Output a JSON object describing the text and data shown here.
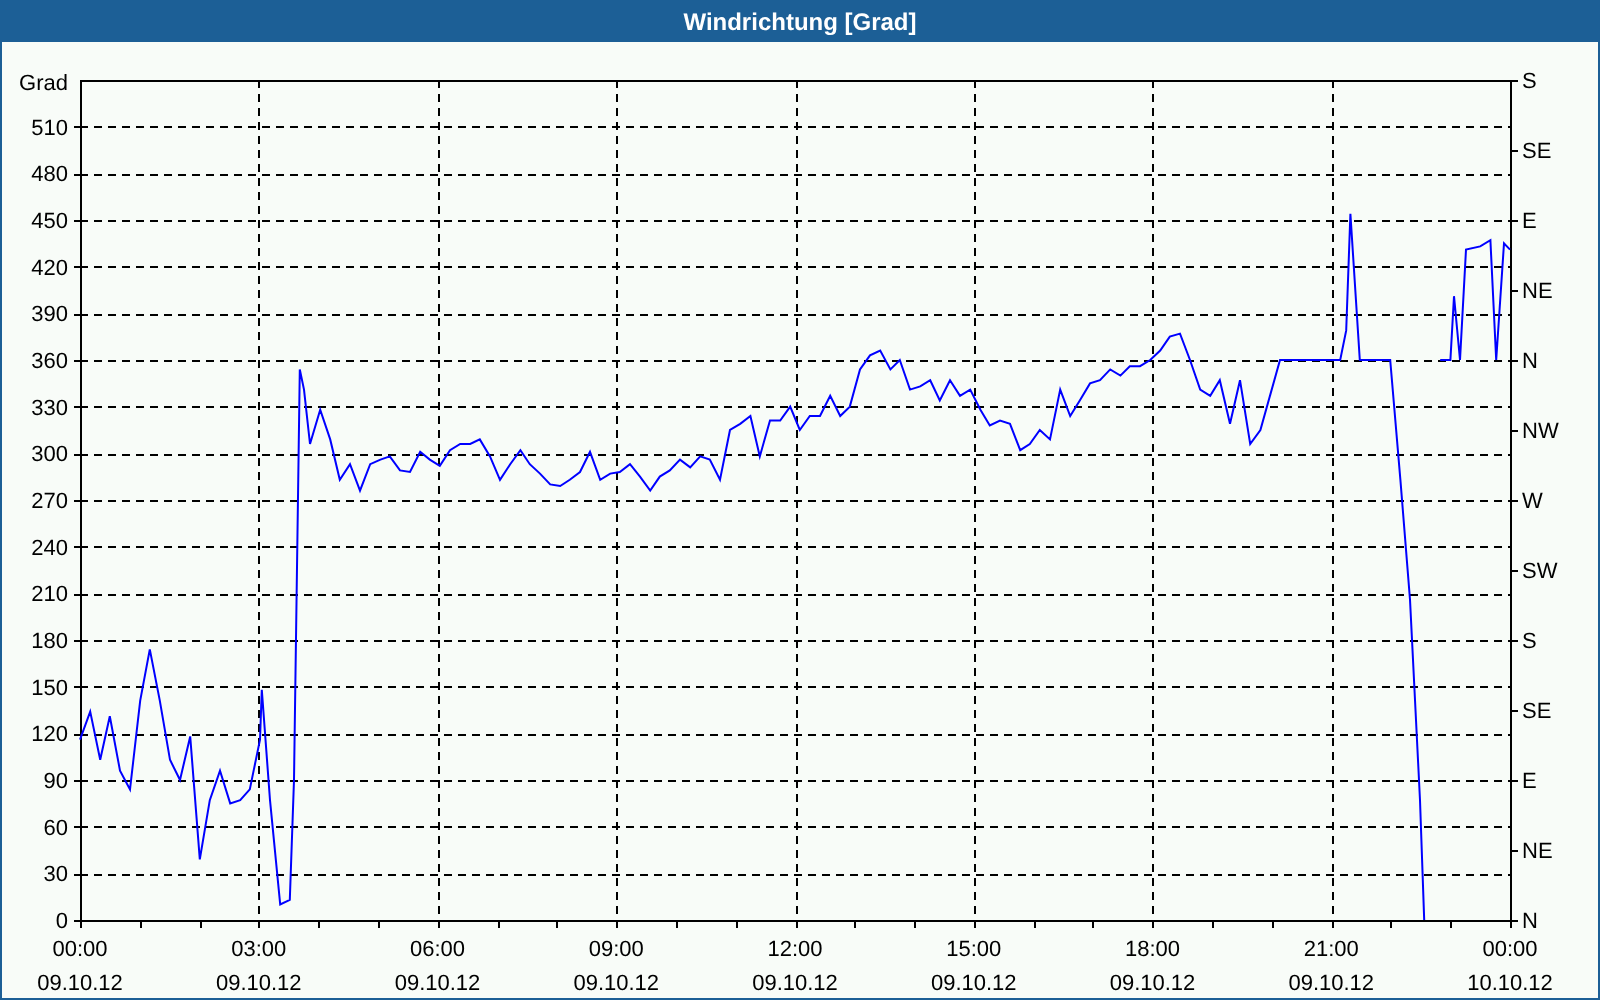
{
  "window": {
    "title": "Windrichtung [Grad]"
  },
  "chart": {
    "date_labels": [
      "09.10.12",
      "09.10.12",
      "09.10.12",
      "09.10.12",
      "09.10.12",
      "09.10.12",
      "09.10.12",
      "09.10.12",
      "10.10.12"
    ],
    "right_axis_labels": [
      "S",
      "SE",
      "E",
      "NE",
      "N",
      "NW",
      "W",
      "SW",
      "S",
      "SE",
      "E",
      "NE",
      "N"
    ],
    "chart_data": {
      "type": "line",
      "ylabel": "Grad",
      "xlim": [
        0,
        24
      ],
      "ylim": [
        0,
        540
      ],
      "grid": true,
      "xticks": [
        {
          "value": 0,
          "label": "00:00"
        },
        {
          "value": 3,
          "label": "03:00"
        },
        {
          "value": 6,
          "label": "06:00"
        },
        {
          "value": 9,
          "label": "09:00"
        },
        {
          "value": 12,
          "label": "12:00"
        },
        {
          "value": 15,
          "label": "15:00"
        },
        {
          "value": 18,
          "label": "18:00"
        },
        {
          "value": 21,
          "label": "21:00"
        },
        {
          "value": 24,
          "label": "00:00"
        }
      ],
      "yticks": [
        0,
        30,
        60,
        90,
        120,
        150,
        180,
        210,
        240,
        270,
        300,
        330,
        360,
        390,
        420,
        450,
        480,
        510
      ],
      "x": [
        0,
        0.17,
        0.34,
        0.5,
        0.67,
        0.84,
        1.01,
        1.17,
        1.34,
        1.51,
        1.68,
        1.85,
        2.01,
        2.18,
        2.35,
        2.52,
        2.69,
        2.85,
        3.02,
        3.05,
        3.19,
        3.36,
        3.52,
        3.59,
        3.69,
        3.76,
        3.86,
        4.03,
        4.2,
        4.36,
        4.53,
        4.7,
        4.87,
        5.04,
        5.2,
        5.37,
        5.54,
        5.71,
        5.87,
        6.04,
        6.21,
        6.38,
        6.55,
        6.71,
        6.88,
        7.05,
        7.22,
        7.39,
        7.55,
        7.72,
        7.89,
        8.06,
        8.22,
        8.39,
        8.56,
        8.73,
        8.9,
        9.06,
        9.23,
        9.4,
        9.57,
        9.73,
        9.9,
        10.07,
        10.24,
        10.41,
        10.57,
        10.74,
        10.91,
        11.08,
        11.25,
        11.41,
        11.58,
        11.75,
        11.92,
        12.08,
        12.25,
        12.42,
        12.59,
        12.76,
        12.92,
        13.09,
        13.26,
        13.43,
        13.6,
        13.76,
        13.93,
        14.1,
        14.27,
        14.43,
        14.6,
        14.77,
        14.94,
        15.11,
        15.27,
        15.44,
        15.61,
        15.78,
        15.94,
        16.11,
        16.28,
        16.45,
        16.62,
        16.78,
        16.95,
        17.12,
        17.29,
        17.46,
        17.62,
        17.79,
        17.96,
        18.13,
        18.29,
        18.46,
        18.63,
        18.8,
        18.97,
        19.13,
        19.3,
        19.47,
        19.64,
        19.81,
        20.14,
        21.15,
        21.25,
        21.32,
        21.48,
        21.99,
        22.16,
        22.32,
        22.49,
        22.56,
        22.7,
        22.83,
        23.0,
        23.06,
        23.16,
        23.26,
        23.5,
        23.67,
        23.77,
        23.9,
        24.0
      ],
      "series": [
        {
          "color": "#0000ff",
          "values": [
            116,
            134,
            103,
            131,
            96,
            84,
            141,
            174,
            141,
            103,
            90,
            118,
            39,
            77,
            96,
            75,
            77,
            84,
            116,
            148,
            77,
            10,
            13,
            90,
            354,
            341,
            306,
            328,
            309,
            283,
            293,
            276,
            293,
            296,
            298,
            289,
            288,
            301,
            296,
            292,
            302,
            306,
            306,
            309,
            298,
            283,
            293,
            302,
            293,
            287,
            280,
            279,
            283,
            288,
            301,
            283,
            287,
            288,
            293,
            285,
            276,
            285,
            289,
            296,
            291,
            298,
            296,
            283,
            315,
            319,
            324,
            298,
            321,
            321,
            330,
            315,
            324,
            324,
            337,
            324,
            330,
            354,
            363,
            366,
            354,
            360,
            341,
            343,
            347,
            334,
            347,
            337,
            341,
            328,
            318,
            321,
            319,
            302,
            306,
            315,
            309,
            341,
            324,
            334,
            345,
            347,
            354,
            350,
            356,
            356,
            360,
            366,
            375,
            377,
            360,
            341,
            337,
            347,
            319,
            347,
            306,
            315,
            360,
            360,
            379,
            454,
            360,
            360,
            283,
            206,
            77,
            0,
            null,
            360,
            360,
            401,
            360,
            431,
            433,
            437,
            360,
            435,
            431
          ]
        }
      ]
    }
  }
}
